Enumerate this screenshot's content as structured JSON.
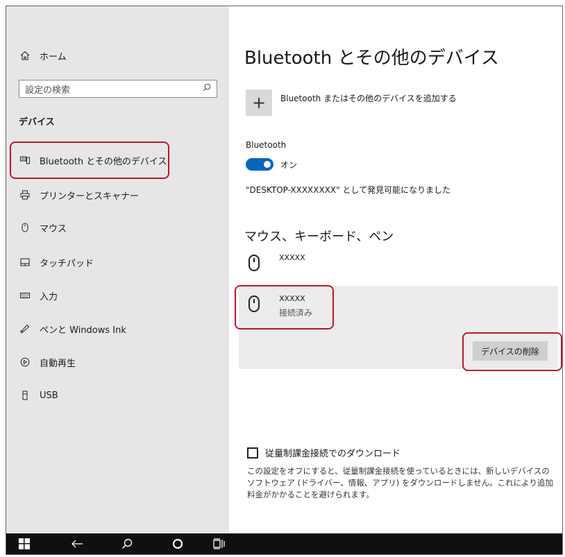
{
  "sidebar": {
    "home_label": "ホーム",
    "search_placeholder": "設定の検索",
    "section_title": "デバイス",
    "items": [
      {
        "label": "Bluetooth とその他のデバイス",
        "icon": "bluetooth-devices-icon"
      },
      {
        "label": "プリンターとスキャナー",
        "icon": "printer-icon"
      },
      {
        "label": "マウス",
        "icon": "mouse-icon"
      },
      {
        "label": "タッチパッド",
        "icon": "touchpad-icon"
      },
      {
        "label": "入力",
        "icon": "keyboard-icon"
      },
      {
        "label": "ペンと Windows Ink",
        "icon": "pen-icon"
      },
      {
        "label": "自動再生",
        "icon": "autoplay-icon"
      },
      {
        "label": "USB",
        "icon": "usb-icon"
      }
    ]
  },
  "main": {
    "title": "Bluetooth とその他のデバイス",
    "add_device_label": "Bluetooth またはその他のデバイスを追加する",
    "add_symbol": "+",
    "bluetooth_label": "Bluetooth",
    "toggle_state": "オン",
    "discoverable_text": "\"DESKTOP-XXXXXXXX\" として発見可能になりました",
    "section_heading": "マウス、キーボード、ペン",
    "devices": [
      {
        "name": "XXXXX",
        "status": ""
      },
      {
        "name": "XXXXX",
        "status": "接続済み"
      }
    ],
    "remove_button": "デバイスの削除",
    "metered_checkbox_label": "従量制課金接続でのダウンロード",
    "metered_description": "この設定をオフにすると、従量制課金接続を使っているときには、新しいデバイスのソフトウェア (ドライバー、情報、アプリ) をダウンロードしません。これにより追加料金がかかることを避けられます。"
  },
  "taskbar": {
    "icons": [
      "windows-start-icon",
      "back-arrow-icon",
      "search-icon",
      "cortana-icon",
      "task-view-icon"
    ]
  },
  "colors": {
    "accent": "#0067c0",
    "highlight": "#c8102e",
    "sidebar_bg": "#e6e6e6",
    "taskbar_bg": "#101010"
  }
}
